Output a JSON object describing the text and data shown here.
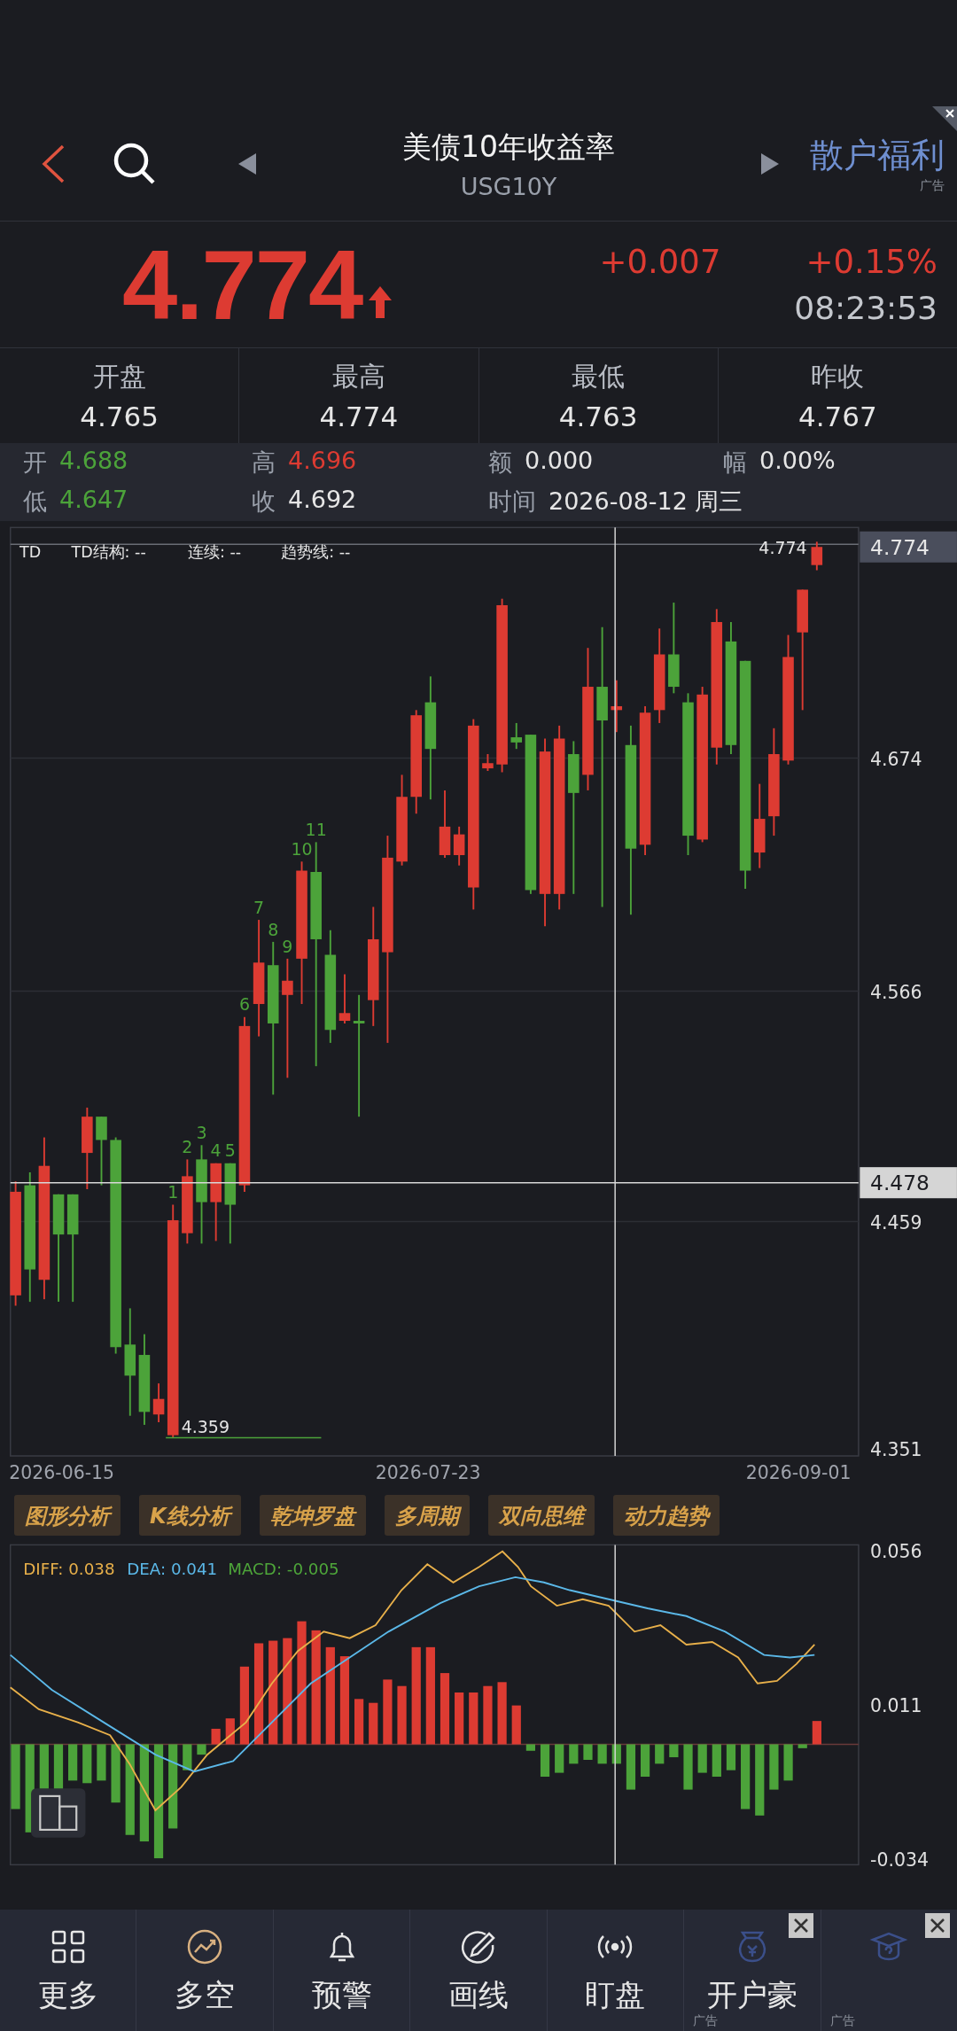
{
  "header": {
    "title": "美债10年收益率",
    "symbol": "USG10Y",
    "ad": {
      "label": "散户福利",
      "tag": "广告"
    }
  },
  "quote": {
    "price": "4.774",
    "rising": true,
    "change": "+0.007",
    "change_pct": "+0.15%",
    "time": "08:23:53"
  },
  "stats": [
    {
      "label": "开盘",
      "value": "4.765"
    },
    {
      "label": "最高",
      "value": "4.774"
    },
    {
      "label": "最低",
      "value": "4.763"
    },
    {
      "label": "昨收",
      "value": "4.767"
    }
  ],
  "bar_info": [
    {
      "label": "开",
      "value": "4.688",
      "color": "#4ca33a"
    },
    {
      "label": "高",
      "value": "4.696",
      "color": "#dd3b32"
    },
    {
      "label": "额",
      "value": "0.000",
      "color": "#e6e6e6"
    },
    {
      "label": "幅",
      "value": "0.00%",
      "color": "#e6e6e6"
    },
    {
      "label": "低",
      "value": "4.647",
      "color": "#4ca33a"
    },
    {
      "label": "收",
      "value": "4.692",
      "color": "#e6e6e6"
    },
    {
      "label": "时间",
      "value": "2026-08-12 周三",
      "color": "#e6e6e6"
    }
  ],
  "kline": {
    "indicator": "TD",
    "legend": [
      {
        "label": "TD结构:",
        "value": "--"
      },
      {
        "label": "连续:",
        "value": "--"
      },
      {
        "label": "趋势线:",
        "value": "--"
      }
    ],
    "y_labels": [
      {
        "text": "4.774",
        "highlighted": true
      },
      {
        "text": "4.674",
        "highlighted": false
      },
      {
        "text": "4.566",
        "highlighted": false
      },
      {
        "text": "4.478",
        "highlighted": true
      },
      {
        "text": "4.459",
        "highlighted": false
      },
      {
        "text": "4.351",
        "highlighted": false
      }
    ],
    "last_label": "4.774",
    "low_label": "4.359",
    "td_counts": [
      "1",
      "2",
      "3",
      "4",
      "5",
      "6",
      "7",
      "8",
      "9",
      "10",
      "11"
    ],
    "dates": [
      "2026-06-15",
      "2026-07-23",
      "2026-09-01"
    ]
  },
  "analysis_buttons": [
    "图形分析",
    "K线分析",
    "乾坤罗盘",
    "多周期",
    "双向思维",
    "动力趋势"
  ],
  "macd": {
    "legend": [
      {
        "kind": "diff",
        "text": "DIFF: 0.038"
      },
      {
        "kind": "dea",
        "text": "DEA: 0.041"
      },
      {
        "kind": "macd",
        "text": "MACD: -0.005"
      }
    ],
    "y_labels": [
      "0.056",
      "0.011",
      "-0.034"
    ]
  },
  "nav": [
    {
      "kind": "grid",
      "label": "更多",
      "ad": false
    },
    {
      "kind": "trend",
      "label": "多空",
      "ad": false
    },
    {
      "kind": "bell",
      "label": "预警",
      "ad": false
    },
    {
      "kind": "draw",
      "label": "画线",
      "ad": false
    },
    {
      "kind": "signal",
      "label": "盯盘",
      "ad": false
    },
    {
      "kind": "bag",
      "label": "开户豪",
      "ad": true,
      "ad_tag": "广告"
    },
    {
      "kind": "cap",
      "ad": true,
      "ad_tag": "广告"
    }
  ]
}
